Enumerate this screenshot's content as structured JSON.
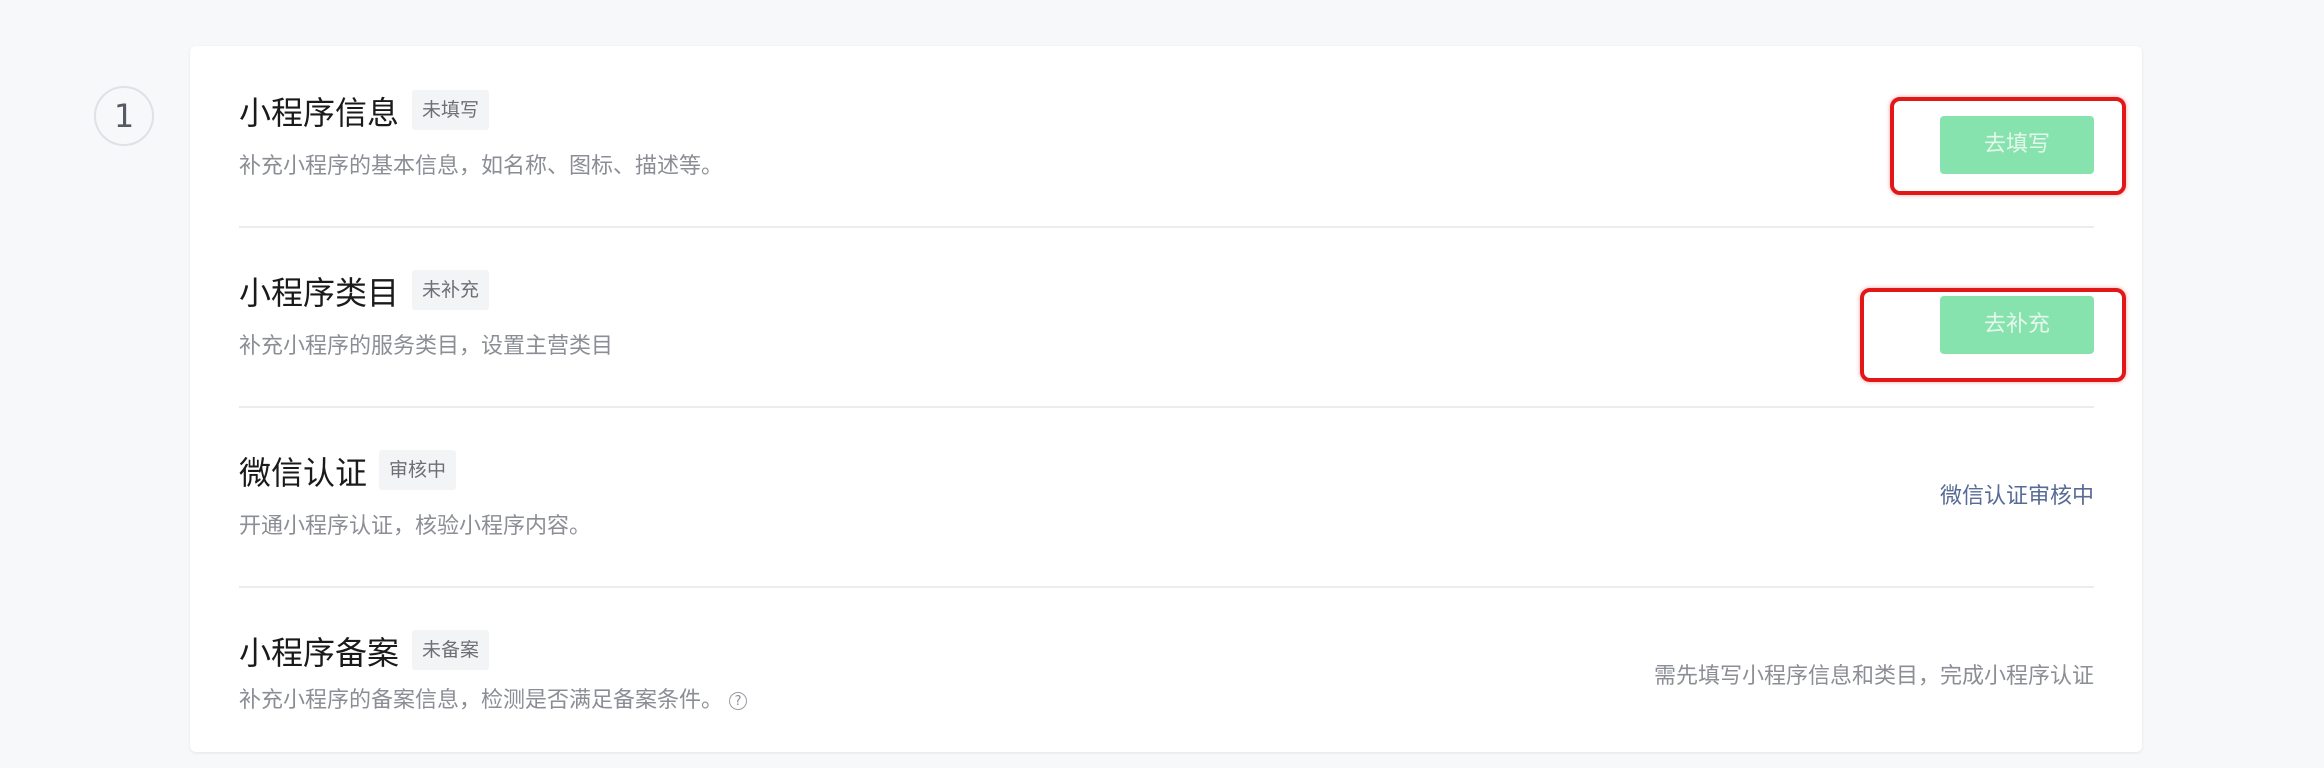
{
  "step": {
    "number": "1"
  },
  "rows": [
    {
      "title": "小程序信息",
      "badge": "未填写",
      "desc": "补充小程序的基本信息，如名称、图标、描述等。",
      "action_label": "去填写"
    },
    {
      "title": "小程序类目",
      "badge": "未补充",
      "desc": "补充小程序的服务类目，设置主营类目",
      "action_label": "去补充"
    },
    {
      "title": "微信认证",
      "badge": "审核中",
      "desc": "开通小程序认证，核验小程序内容。",
      "status_text": "微信认证审核中"
    },
    {
      "title": "小程序备案",
      "badge": "未备案",
      "desc": "补充小程序的备案信息，检测是否满足备案条件。",
      "help_icon": "question-circle-icon",
      "status_text": "需先填写小程序信息和类目，完成小程序认证"
    }
  ],
  "colors": {
    "primary_disabled": "#86e3ae",
    "highlight": "#e21818",
    "status_link": "#576b95",
    "status_muted": "#8b8e94"
  }
}
